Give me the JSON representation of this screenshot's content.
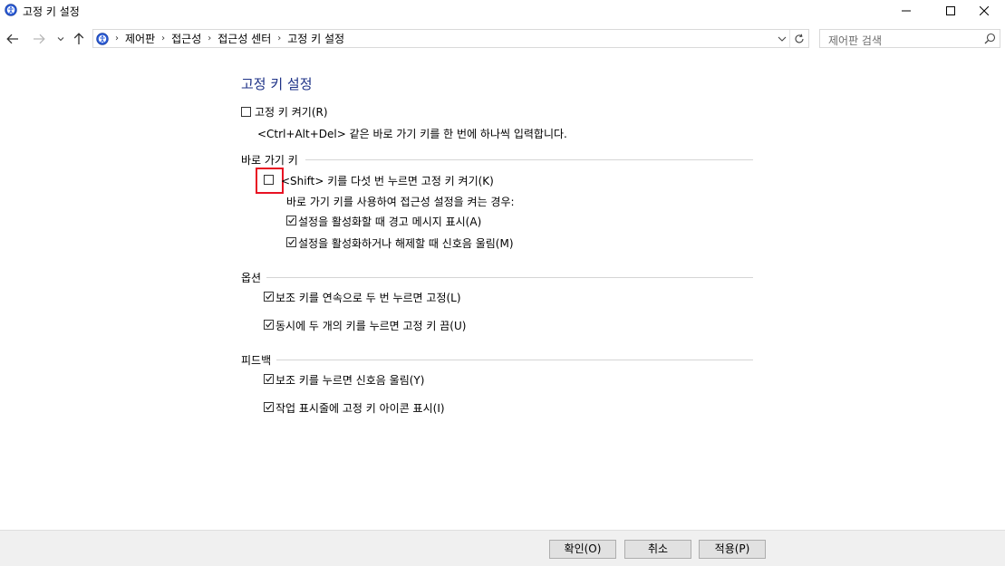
{
  "window": {
    "title": "고정 키 설정"
  },
  "address_bar": {
    "crumbs": [
      "제어판",
      "접근성",
      "접근성 센터",
      "고정 키 설정"
    ]
  },
  "search": {
    "placeholder": "제어판 검색"
  },
  "page": {
    "title": "고정 키 설정",
    "turn_on": {
      "label": "고정 키 켜기(R)",
      "checked": false
    },
    "description": "<Ctrl+Alt+Del> 같은 바로 가기 키를 한 번에 하나씩 입력합니다.",
    "shortcut_section": {
      "title": "바로 가기 키",
      "shift_five": {
        "label": "<Shift> 키를 다섯 번 누르면 고정 키 켜기(K)",
        "checked": false
      },
      "sub_heading": "바로 가기 키를 사용하여 접근성 설정을 켜는 경우:",
      "warning": {
        "label": "설정을 활성화할 때 경고 메시지 표시(A)",
        "checked": true
      },
      "sound": {
        "label": "설정을 활성화하거나 해제할 때 신호음 울림(M)",
        "checked": true
      }
    },
    "options_section": {
      "title": "옵션",
      "lock_double": {
        "label": "보조 키를 연속으로 두 번 누르면 고정(L)",
        "checked": true
      },
      "turn_off_two": {
        "label": "동시에 두 개의 키를 누르면 고정 키 끔(U)",
        "checked": true
      }
    },
    "feedback_section": {
      "title": "피드백",
      "beep": {
        "label": "보조 키를 누르면 신호음 울림(Y)",
        "checked": true
      },
      "taskbar_icon": {
        "label": "작업 표시줄에 고정 키 아이콘 표시(I)",
        "checked": true
      }
    }
  },
  "footer": {
    "ok": "확인(O)",
    "cancel": "취소",
    "apply": "적용(P)"
  }
}
